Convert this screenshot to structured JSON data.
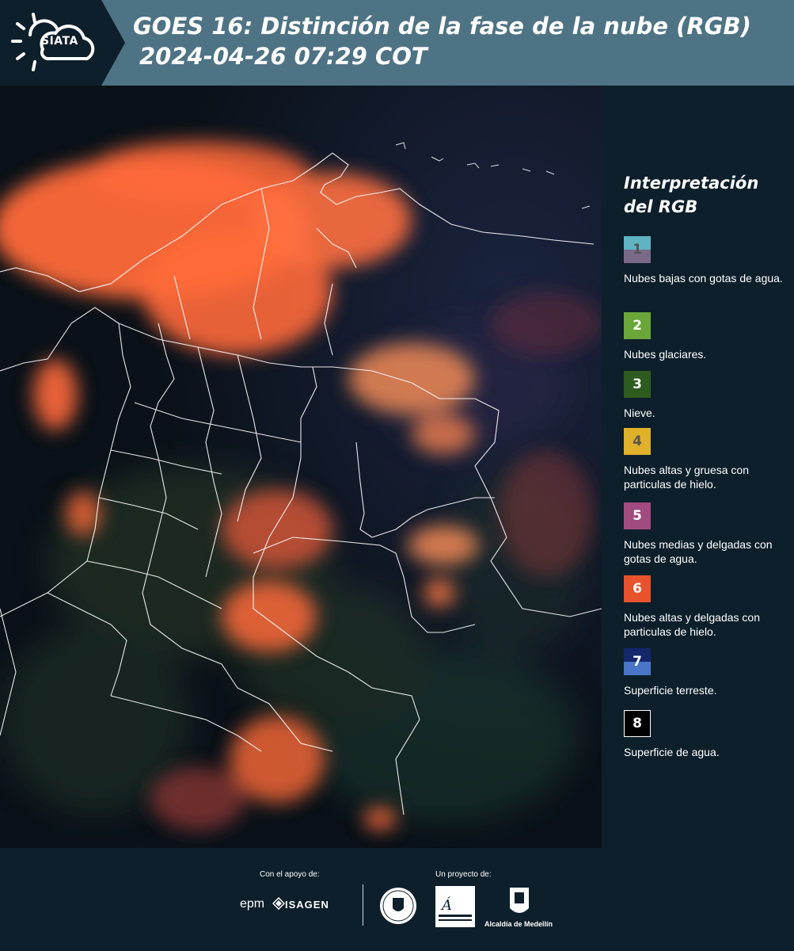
{
  "header": {
    "logo_text": "SIATA",
    "title_line1": "GOES 16: Distinción de la fase de la nube (RGB)",
    "title_line2": "2024-04-26 07:29 COT"
  },
  "legend": {
    "title": "Interpretación del RGB",
    "items": [
      {
        "number": "1",
        "label": "Nubes bajas con gotas de agua.",
        "color_top": "#5fb3c2",
        "color_bottom": "#7a6a8a",
        "text_color": "#555555"
      },
      {
        "number": "2",
        "label": "Nubes glaciares.",
        "color_top": "#6aa63a",
        "color_bottom": "#6aa63a",
        "text_color": "#ffffff"
      },
      {
        "number": "3",
        "label": "Nieve.",
        "color_top": "#2e5b1f",
        "color_bottom": "#2e5b1f",
        "text_color": "#ffffff"
      },
      {
        "number": "4",
        "label": "Nubes altas y gruesa con particulas de hielo.",
        "color_top": "#e0b12a",
        "color_bottom": "#e0b12a",
        "text_color": "#555555"
      },
      {
        "number": "5",
        "label": "Nubes medias y delgadas con gotas de agua.",
        "color_top": "#a24b80",
        "color_bottom": "#a24b80",
        "text_color": "#ffffff"
      },
      {
        "number": "6",
        "label": "Nubes altas y delgadas con particulas de hielo.",
        "color_top": "#e8522c",
        "color_bottom": "#e8522c",
        "text_color": "#ffffff"
      },
      {
        "number": "7",
        "label": "Superficie terreste.",
        "color_top": "#14286b",
        "color_bottom": "#4a76c8",
        "text_color": "#ffffff"
      },
      {
        "number": "8",
        "label": "Superficie de agua.",
        "color_top": "#000000",
        "color_bottom": "#000000",
        "text_color": "#ffffff"
      }
    ]
  },
  "footer": {
    "support_label": "Con el apoyo de:",
    "project_label": "Un proyecto de:",
    "epm": "epm",
    "isagen": "ISAGEN",
    "alcaldia": "Alcaldía de Medellín"
  },
  "colors": {
    "header_bg": "#4e7384",
    "panel_bg": "#0d1f2b",
    "cloud_orange": "#ff6a3a"
  }
}
